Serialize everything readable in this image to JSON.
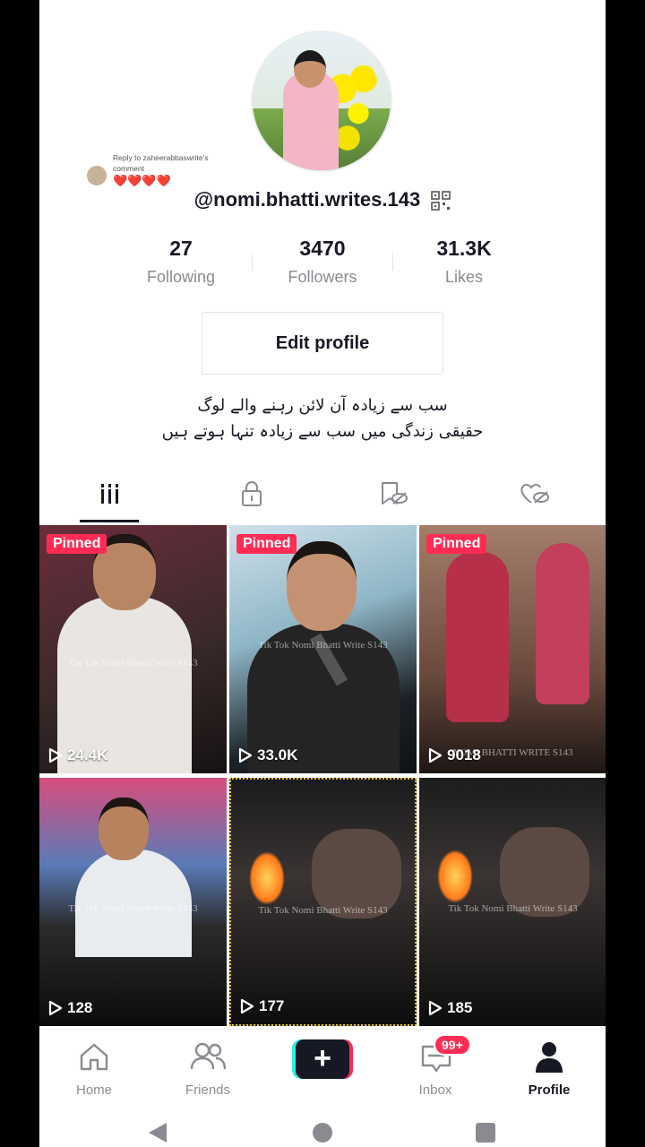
{
  "profile": {
    "handle": "@nomi.bhatti.writes.143",
    "reply_caption": "Reply to zaheerabbaswrite's comment",
    "reply_hearts": "❤️❤️❤️❤️",
    "bio_line1": "سب سے زیادہ آن لائن رہنے والے لوگ",
    "bio_line2": "حقیقی زندگی میں سب سے زیادہ تنہا ہوتے ہیں",
    "edit_label": "Edit profile"
  },
  "stats": [
    {
      "value": "27",
      "label": "Following"
    },
    {
      "value": "3470",
      "label": "Followers"
    },
    {
      "value": "31.3K",
      "label": "Likes"
    }
  ],
  "tabs": [
    {
      "icon": "grid-icon",
      "active": true
    },
    {
      "icon": "lock-icon",
      "active": false
    },
    {
      "icon": "bookmark-eye-icon",
      "active": false
    },
    {
      "icon": "heart-eye-icon",
      "active": false
    }
  ],
  "videos": [
    {
      "pinned_label": "Pinned",
      "views": "24.4K",
      "watermark": "Tik Tok Nomi Bhatti Write S143"
    },
    {
      "pinned_label": "Pinned",
      "views": "33.0K",
      "watermark": "Tik Tok Nomi Bhatti Write S143"
    },
    {
      "pinned_label": "Pinned",
      "views": "9018",
      "watermark": "NOMI BHATTI WRITE S143"
    },
    {
      "pinned_label": "",
      "views": "128",
      "watermark": "Tik Tok Nomi Bhatti Write S143"
    },
    {
      "pinned_label": "",
      "views": "177",
      "watermark": "Tik Tok Nomi Bhatti Write S143"
    },
    {
      "pinned_label": "",
      "views": "185",
      "watermark": "Tik Tok Nomi Bhatti Write S143"
    }
  ],
  "nav": {
    "home": "Home",
    "friends": "Friends",
    "inbox": "Inbox",
    "inbox_badge": "99+",
    "profile": "Profile"
  },
  "colors": {
    "accent": "#fe2c55",
    "cyan": "#25f4ee",
    "text": "#161823",
    "muted": "#8a8b91"
  }
}
